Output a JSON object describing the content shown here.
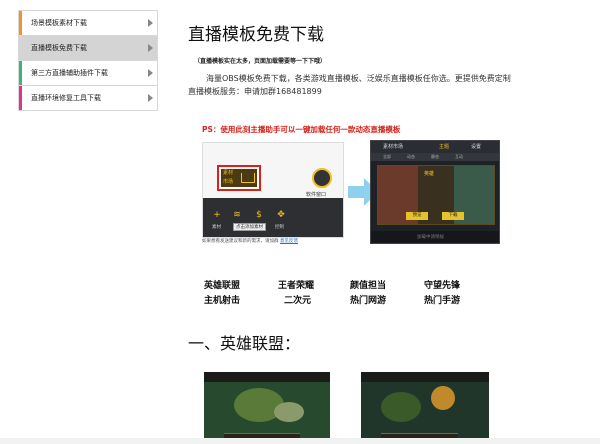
{
  "sidebar": {
    "items": [
      {
        "label": "场景模板素材下载",
        "accent": "#f0922e",
        "active": false
      },
      {
        "label": "直播模板免费下载",
        "accent": "#d4d4d4",
        "active": true
      },
      {
        "label": "第三方直播辅助插件下载",
        "accent": "#3bb57a",
        "active": false
      },
      {
        "label": "直播环境修复工具下载",
        "accent": "#e0338a",
        "active": false
      }
    ]
  },
  "main": {
    "title": "直播模板免费下载",
    "note": "（直播模板实在太多，页面加载需要等一下下哦）",
    "paragraph": "海量OBS模板免费下载，各类游戏直播模板、泛娱乐直播模板任你选。更提供免费定制直播模板服务：申请加群168481899",
    "ps": "PS：使用此刻主播助手可以一键加载任何一款动态直播模板",
    "demo": {
      "sucai_label_1": "素材",
      "sucai_label_2": "市场",
      "soft_label": "软件窗口",
      "tools": [
        "+",
        "≋",
        "$",
        "✥"
      ],
      "tool_labels": [
        "素材",
        "",
        "",
        "控制"
      ],
      "tooltip": "点击添加素材",
      "hint_text": "如果想看发送建议和新的需求，请加群",
      "hint_link": "意见反馈",
      "right_head_left": "素材市场",
      "right_head_mid": "主题",
      "right_head_right": "设置",
      "right_tabs": [
        "全部",
        "动态",
        "静态",
        "互动"
      ],
      "right_title": "英雄",
      "right_btn_1": "预览",
      "right_btn_2": "下载",
      "right_footer": "加载中请稍候"
    },
    "games": [
      [
        "英雄联盟",
        "王者荣耀",
        "颜值担当",
        "守望先锋"
      ],
      [
        "主机射击",
        "二次元",
        "热门网游",
        "热门手游"
      ]
    ],
    "section_title": "一、英雄联盟："
  }
}
